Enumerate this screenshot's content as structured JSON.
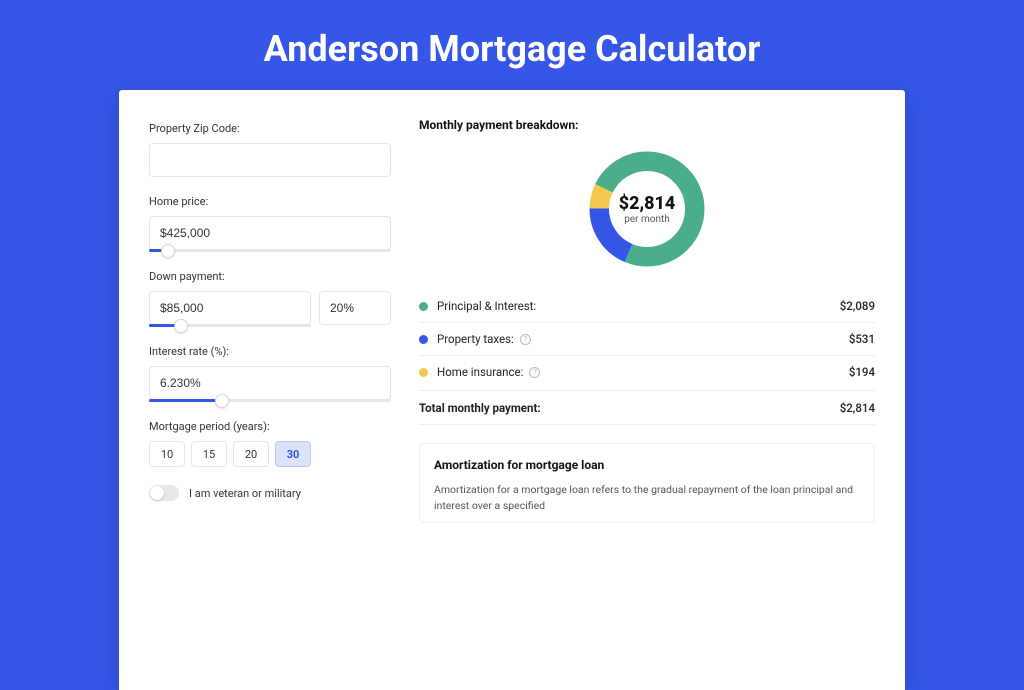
{
  "title": "Anderson Mortgage Calculator",
  "colors": {
    "principal": "#4AAE8C",
    "taxes": "#3656E8",
    "insurance": "#F2C94C"
  },
  "form": {
    "zip_label": "Property Zip Code:",
    "zip_value": "",
    "price_label": "Home price:",
    "price_value": "$425,000",
    "price_slider_pct": 8,
    "down_label": "Down payment:",
    "down_value": "$85,000",
    "down_pct_value": "20%",
    "down_slider_pct": 20,
    "rate_label": "Interest rate (%):",
    "rate_value": "6.230%",
    "rate_slider_pct": 30,
    "period_label": "Mortgage period (years):",
    "periods": [
      "10",
      "15",
      "20",
      "30"
    ],
    "period_selected": "30",
    "veteran_label": "I am veteran or military"
  },
  "breakdown": {
    "heading": "Monthly payment breakdown:",
    "total_amount": "$2,814",
    "total_sub": "per month",
    "rows": [
      {
        "key": "principal",
        "label": "Principal & Interest:",
        "value": "$2,089",
        "color": "#4AAE8C",
        "info": false
      },
      {
        "key": "taxes",
        "label": "Property taxes:",
        "value": "$531",
        "color": "#3656E8",
        "info": true
      },
      {
        "key": "insurance",
        "label": "Home insurance:",
        "value": "$194",
        "color": "#F2C94C",
        "info": true
      }
    ],
    "total_label": "Total monthly payment:",
    "total_value": "$2,814"
  },
  "chart_data": {
    "type": "pie",
    "title": "Monthly payment breakdown",
    "series": [
      {
        "name": "Principal & Interest",
        "value": 2089,
        "color": "#4AAE8C"
      },
      {
        "name": "Property taxes",
        "value": 531,
        "color": "#3656E8"
      },
      {
        "name": "Home insurance",
        "value": 194,
        "color": "#F2C94C"
      }
    ],
    "total": 2814,
    "center_label": "$2,814",
    "center_sub": "per month"
  },
  "amort": {
    "title": "Amortization for mortgage loan",
    "text": "Amortization for a mortgage loan refers to the gradual repayment of the loan principal and interest over a specified"
  }
}
